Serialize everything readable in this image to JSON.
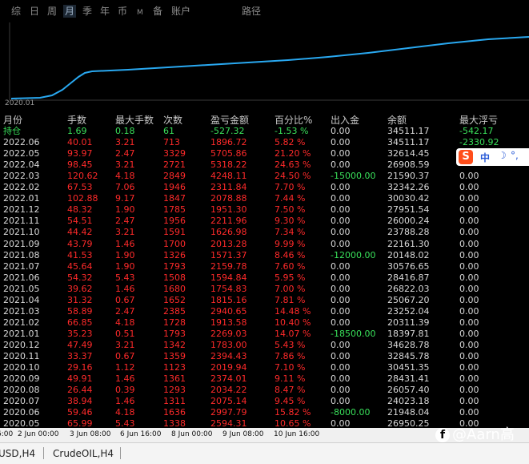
{
  "period_tabs": [
    {
      "label": "综",
      "active": false
    },
    {
      "label": "日",
      "active": false
    },
    {
      "label": "周",
      "active": false
    },
    {
      "label": "月",
      "active": true
    },
    {
      "label": "季",
      "active": false
    },
    {
      "label": "年",
      "active": false
    },
    {
      "label": "币",
      "active": false
    },
    {
      "label": "M",
      "active": false
    },
    {
      "label": "备",
      "active": false
    },
    {
      "label": "账户",
      "active": false
    },
    {
      "label": "路径",
      "active": false
    }
  ],
  "chart": {
    "start_label": "2020.01",
    "line_color": "#29a8f0"
  },
  "table": {
    "headers": [
      "月份",
      "手数",
      "最大手数",
      "次数",
      "盈亏金额",
      "百分比%",
      "出入金",
      "余额",
      "最大浮亏"
    ],
    "summary": {
      "month": "持仓",
      "lots": "1.69",
      "max_lots": "0.18",
      "count": "61",
      "pnl": "-527.32",
      "pct": "-1.53 %",
      "flow": "0.00",
      "balance": "34511.17",
      "max_float": "-542.17"
    },
    "rows": [
      {
        "month": "2022.06",
        "lots": "40.01",
        "max_lots": "3.21",
        "count": "713",
        "pnl": "1896.72",
        "pct": "5.82 %",
        "flow": "0.00",
        "balance": "34511.17",
        "max_float": "-2330.92",
        "float_neg": true
      },
      {
        "month": "2022.05",
        "lots": "93.97",
        "max_lots": "2.47",
        "count": "3329",
        "pnl": "5705.86",
        "pct": "21.20 %",
        "flow": "0.00",
        "balance": "32614.45",
        "max_float": "",
        "float_neg": false
      },
      {
        "month": "2022.04",
        "lots": "98.45",
        "max_lots": "3.21",
        "count": "2721",
        "pnl": "5318.22",
        "pct": "24.63 %",
        "flow": "0.00",
        "balance": "26908.59",
        "max_float": "",
        "float_neg": false
      },
      {
        "month": "2022.03",
        "lots": "120.62",
        "max_lots": "4.18",
        "count": "2849",
        "pnl": "4248.11",
        "pct": "24.50 %",
        "flow": "-15000.00",
        "balance": "21590.37",
        "max_float": "0.00",
        "float_neg": false
      },
      {
        "month": "2022.02",
        "lots": "67.53",
        "max_lots": "7.06",
        "count": "1946",
        "pnl": "2311.84",
        "pct": "7.70 %",
        "flow": "0.00",
        "balance": "32342.26",
        "max_float": "0.00",
        "float_neg": false
      },
      {
        "month": "2022.01",
        "lots": "102.88",
        "max_lots": "9.17",
        "count": "1847",
        "pnl": "2078.88",
        "pct": "7.44 %",
        "flow": "0.00",
        "balance": "30030.42",
        "max_float": "0.00",
        "float_neg": false
      },
      {
        "month": "2021.12",
        "lots": "48.32",
        "max_lots": "1.90",
        "count": "1785",
        "pnl": "1951.30",
        "pct": "7.50 %",
        "flow": "0.00",
        "balance": "27951.54",
        "max_float": "0.00",
        "float_neg": false
      },
      {
        "month": "2021.11",
        "lots": "54.51",
        "max_lots": "2.47",
        "count": "1956",
        "pnl": "2211.96",
        "pct": "9.30 %",
        "flow": "0.00",
        "balance": "26000.24",
        "max_float": "0.00",
        "float_neg": false
      },
      {
        "month": "2021.10",
        "lots": "44.42",
        "max_lots": "3.21",
        "count": "1591",
        "pnl": "1626.98",
        "pct": "7.34 %",
        "flow": "0.00",
        "balance": "23788.28",
        "max_float": "0.00",
        "float_neg": false
      },
      {
        "month": "2021.09",
        "lots": "43.79",
        "max_lots": "1.46",
        "count": "1700",
        "pnl": "2013.28",
        "pct": "9.99 %",
        "flow": "0.00",
        "balance": "22161.30",
        "max_float": "0.00",
        "float_neg": false
      },
      {
        "month": "2021.08",
        "lots": "41.53",
        "max_lots": "1.90",
        "count": "1326",
        "pnl": "1571.37",
        "pct": "8.46 %",
        "flow": "-12000.00",
        "balance": "20148.02",
        "max_float": "0.00",
        "float_neg": false
      },
      {
        "month": "2021.07",
        "lots": "45.64",
        "max_lots": "1.90",
        "count": "1793",
        "pnl": "2159.78",
        "pct": "7.60 %",
        "flow": "0.00",
        "balance": "30576.65",
        "max_float": "0.00",
        "float_neg": false
      },
      {
        "month": "2021.06",
        "lots": "54.32",
        "max_lots": "5.43",
        "count": "1508",
        "pnl": "1594.84",
        "pct": "5.95 %",
        "flow": "0.00",
        "balance": "28416.87",
        "max_float": "0.00",
        "float_neg": false
      },
      {
        "month": "2021.05",
        "lots": "39.62",
        "max_lots": "1.46",
        "count": "1680",
        "pnl": "1754.83",
        "pct": "7.00 %",
        "flow": "0.00",
        "balance": "26822.03",
        "max_float": "0.00",
        "float_neg": false
      },
      {
        "month": "2021.04",
        "lots": "31.32",
        "max_lots": "0.67",
        "count": "1652",
        "pnl": "1815.16",
        "pct": "7.81 %",
        "flow": "0.00",
        "balance": "25067.20",
        "max_float": "0.00",
        "float_neg": false
      },
      {
        "month": "2021.03",
        "lots": "58.89",
        "max_lots": "2.47",
        "count": "2385",
        "pnl": "2940.65",
        "pct": "14.48 %",
        "flow": "0.00",
        "balance": "23252.04",
        "max_float": "0.00",
        "float_neg": false
      },
      {
        "month": "2021.02",
        "lots": "66.85",
        "max_lots": "4.18",
        "count": "1728",
        "pnl": "1913.58",
        "pct": "10.40 %",
        "flow": "0.00",
        "balance": "20311.39",
        "max_float": "0.00",
        "float_neg": false
      },
      {
        "month": "2021.01",
        "lots": "35.23",
        "max_lots": "0.51",
        "count": "1793",
        "pnl": "2269.03",
        "pct": "14.07 %",
        "flow": "-18500.00",
        "balance": "18397.81",
        "max_float": "0.00",
        "float_neg": false
      },
      {
        "month": "2020.12",
        "lots": "47.49",
        "max_lots": "3.21",
        "count": "1342",
        "pnl": "1783.00",
        "pct": "5.43 %",
        "flow": "0.00",
        "balance": "34628.78",
        "max_float": "0.00",
        "float_neg": false
      },
      {
        "month": "2020.11",
        "lots": "33.37",
        "max_lots": "0.67",
        "count": "1359",
        "pnl": "2394.43",
        "pct": "7.86 %",
        "flow": "0.00",
        "balance": "32845.78",
        "max_float": "0.00",
        "float_neg": false
      },
      {
        "month": "2020.10",
        "lots": "29.16",
        "max_lots": "1.12",
        "count": "1123",
        "pnl": "2019.94",
        "pct": "7.10 %",
        "flow": "0.00",
        "balance": "30451.35",
        "max_float": "0.00",
        "float_neg": false
      },
      {
        "month": "2020.09",
        "lots": "49.91",
        "max_lots": "1.46",
        "count": "1361",
        "pnl": "2374.01",
        "pct": "9.11 %",
        "flow": "0.00",
        "balance": "28431.41",
        "max_float": "0.00",
        "float_neg": false
      },
      {
        "month": "2020.08",
        "lots": "26.44",
        "max_lots": "0.39",
        "count": "1293",
        "pnl": "2034.22",
        "pct": "8.47 %",
        "flow": "0.00",
        "balance": "26057.40",
        "max_float": "0.00",
        "float_neg": false
      },
      {
        "month": "2020.07",
        "lots": "38.94",
        "max_lots": "1.46",
        "count": "1311",
        "pnl": "2075.14",
        "pct": "9.45 %",
        "flow": "0.00",
        "balance": "24023.18",
        "max_float": "0.00",
        "float_neg": false
      },
      {
        "month": "2020.06",
        "lots": "59.46",
        "max_lots": "4.18",
        "count": "1636",
        "pnl": "2997.79",
        "pct": "15.82 %",
        "flow": "-8000.00",
        "balance": "21948.04",
        "max_float": "0.00",
        "float_neg": false
      },
      {
        "month": "2020.05",
        "lots": "65.99",
        "max_lots": "5.43",
        "count": "1338",
        "pnl": "2594.31",
        "pct": "10.65 %",
        "flow": "0.00",
        "balance": "26950.25",
        "max_float": "0.00",
        "float_neg": false
      }
    ]
  },
  "ime": {
    "logo": "S",
    "mode": "中",
    "moon": "☽",
    "punct": "°,"
  },
  "timeline": [
    "6:00",
    "2 Jun 00:00",
    "3 Jun 08:00",
    "6 Jun 16:00",
    "8 Jun 00:00",
    "9 Jun 08:00",
    "10 Jun 16:00"
  ],
  "symbol_tabs": [
    "USD,H4",
    "CrudeOIL,H4"
  ],
  "watermark": "@Aarn高"
}
